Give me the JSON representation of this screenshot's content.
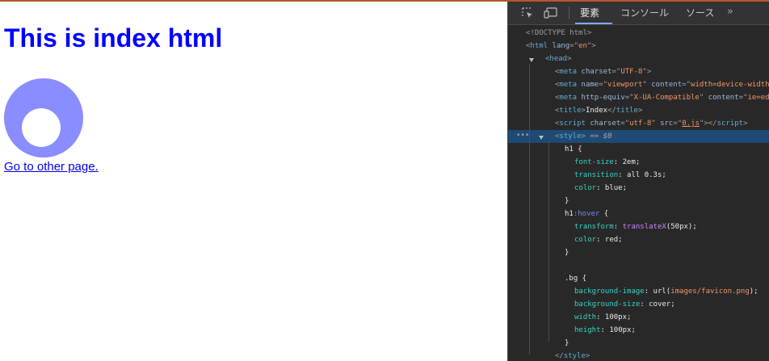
{
  "page": {
    "heading": "This is index html",
    "link_text": "Go to other page.",
    "ring_color": "#8a8dff"
  },
  "devtools": {
    "tabs": [
      {
        "label": "要素",
        "active": true
      },
      {
        "label": "コンソール",
        "active": false
      },
      {
        "label": "ソース",
        "active": false
      }
    ],
    "more_icon": "chevron-double-right-icon",
    "lines": [
      [
        {
          "t": "<!DOCTYPE html>",
          "c": "c-punc"
        }
      ],
      [
        {
          "t": "<",
          "c": "c-punc"
        },
        {
          "t": "html",
          "c": "c-tag"
        },
        {
          "t": " lang",
          "c": "c-attr"
        },
        {
          "t": "=\"",
          "c": "c-punc"
        },
        {
          "t": "en",
          "c": "c-val"
        },
        {
          "t": "\">",
          "c": "c-punc"
        }
      ],
      [
        {
          "t": "<",
          "c": "c-punc"
        },
        {
          "t": "head",
          "c": "c-tag"
        },
        {
          "t": ">",
          "c": "c-punc"
        }
      ],
      [
        {
          "t": "<",
          "c": "c-punc"
        },
        {
          "t": "meta",
          "c": "c-tag"
        },
        {
          "t": " charset",
          "c": "c-attr"
        },
        {
          "t": "=\"",
          "c": "c-punc"
        },
        {
          "t": "UTF-8",
          "c": "c-val"
        },
        {
          "t": "\">",
          "c": "c-punc"
        }
      ],
      [
        {
          "t": "<",
          "c": "c-punc"
        },
        {
          "t": "meta",
          "c": "c-tag"
        },
        {
          "t": " name",
          "c": "c-attr"
        },
        {
          "t": "=\"",
          "c": "c-punc"
        },
        {
          "t": "viewport",
          "c": "c-val"
        },
        {
          "t": "\"",
          "c": "c-punc"
        },
        {
          "t": " content",
          "c": "c-attr"
        },
        {
          "t": "=\"",
          "c": "c-punc"
        },
        {
          "t": "width=device-width,",
          "c": "c-val"
        }
      ],
      [
        {
          "t": "<",
          "c": "c-punc"
        },
        {
          "t": "meta",
          "c": "c-tag"
        },
        {
          "t": " http-equiv",
          "c": "c-attr"
        },
        {
          "t": "=\"",
          "c": "c-punc"
        },
        {
          "t": "X-UA-Compatible",
          "c": "c-val"
        },
        {
          "t": "\"",
          "c": "c-punc"
        },
        {
          "t": " content",
          "c": "c-attr"
        },
        {
          "t": "=\"",
          "c": "c-punc"
        },
        {
          "t": "ie=edge",
          "c": "c-val"
        }
      ],
      [
        {
          "t": "<",
          "c": "c-punc"
        },
        {
          "t": "title",
          "c": "c-tag"
        },
        {
          "t": ">",
          "c": "c-punc"
        },
        {
          "t": "Index",
          "c": "c-text"
        },
        {
          "t": "</",
          "c": "c-punc"
        },
        {
          "t": "title",
          "c": "c-tag"
        },
        {
          "t": ">",
          "c": "c-punc"
        }
      ],
      [
        {
          "t": "<",
          "c": "c-punc"
        },
        {
          "t": "script",
          "c": "c-tag"
        },
        {
          "t": " charset",
          "c": "c-attr"
        },
        {
          "t": "=\"",
          "c": "c-punc"
        },
        {
          "t": "utf-8",
          "c": "c-val"
        },
        {
          "t": "\"",
          "c": "c-punc"
        },
        {
          "t": " src",
          "c": "c-attr"
        },
        {
          "t": "=\"",
          "c": "c-punc"
        },
        {
          "t": "0.js",
          "c": "c-link"
        },
        {
          "t": "\">",
          "c": "c-punc"
        },
        {
          "t": "</",
          "c": "c-punc"
        },
        {
          "t": "script",
          "c": "c-tag"
        },
        {
          "t": ">",
          "c": "c-punc"
        }
      ],
      [
        {
          "t": "<",
          "c": "c-punc"
        },
        {
          "t": "style",
          "c": "c-tag"
        },
        {
          "t": ">",
          "c": "c-punc"
        },
        {
          "t": " == $0",
          "c": "c-eqs"
        }
      ],
      [
        {
          "t": "h1 {",
          "c": "c-sel"
        }
      ],
      [
        {
          "t": "font-size",
          "c": "c-prop"
        },
        {
          "t": ": 2em;",
          "c": "c-text"
        }
      ],
      [
        {
          "t": "transition",
          "c": "c-prop"
        },
        {
          "t": ": all 0.3s;",
          "c": "c-text"
        }
      ],
      [
        {
          "t": "color",
          "c": "c-prop"
        },
        {
          "t": ": blue;",
          "c": "c-text"
        }
      ],
      [
        {
          "t": "}",
          "c": "c-sel"
        }
      ],
      [
        {
          "t": "h1",
          "c": "c-sel"
        },
        {
          "t": ":hover",
          "c": "c-pseudo"
        },
        {
          "t": " {",
          "c": "c-sel"
        }
      ],
      [
        {
          "t": "transform",
          "c": "c-prop"
        },
        {
          "t": ": ",
          "c": "c-text"
        },
        {
          "t": "translateX",
          "c": "c-func"
        },
        {
          "t": "(50px);",
          "c": "c-text"
        }
      ],
      [
        {
          "t": "color",
          "c": "c-prop"
        },
        {
          "t": ": red;",
          "c": "c-text"
        }
      ],
      [
        {
          "t": "}",
          "c": "c-sel"
        }
      ],
      [
        {
          "t": "",
          "c": "c-text"
        }
      ],
      [
        {
          "t": ".bg {",
          "c": "c-sel"
        }
      ],
      [
        {
          "t": "background-image",
          "c": "c-prop"
        },
        {
          "t": ": url(",
          "c": "c-text"
        },
        {
          "t": "images/favicon.png",
          "c": "c-val"
        },
        {
          "t": ");",
          "c": "c-text"
        }
      ],
      [
        {
          "t": "background-size",
          "c": "c-prop"
        },
        {
          "t": ": cover;",
          "c": "c-text"
        }
      ],
      [
        {
          "t": "width",
          "c": "c-prop"
        },
        {
          "t": ": 100px;",
          "c": "c-text"
        }
      ],
      [
        {
          "t": "height",
          "c": "c-prop"
        },
        {
          "t": ": 100px;",
          "c": "c-text"
        }
      ],
      [
        {
          "t": "}",
          "c": "c-sel"
        }
      ],
      [
        {
          "t": "</",
          "c": "c-punc"
        },
        {
          "t": "style",
          "c": "c-tag"
        },
        {
          "t": ">",
          "c": "c-punc"
        }
      ],
      [
        {
          "t": "</",
          "c": "c-punc"
        },
        {
          "t": "head",
          "c": "c-tag"
        },
        {
          "t": ">",
          "c": "c-punc"
        }
      ]
    ],
    "selected_line": 8,
    "dots_label": "•••"
  }
}
